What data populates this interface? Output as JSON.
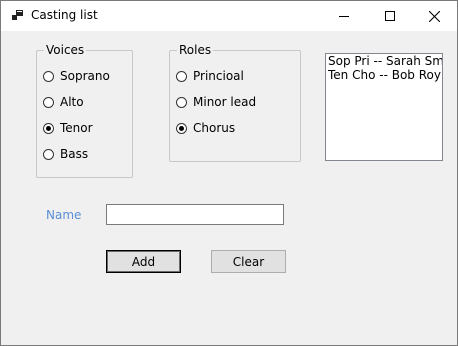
{
  "window": {
    "title": "Casting list",
    "controls": [
      "minimize",
      "maximize",
      "close"
    ]
  },
  "voices": {
    "title": "Voices",
    "options": [
      {
        "label": "Soprano",
        "checked": false
      },
      {
        "label": "Alto",
        "checked": false
      },
      {
        "label": "Tenor",
        "checked": true
      },
      {
        "label": "Bass",
        "checked": false
      }
    ]
  },
  "roles": {
    "title": "Roles",
    "options": [
      {
        "label": "Princioal",
        "checked": false
      },
      {
        "label": "Minor lead",
        "checked": false
      },
      {
        "label": "Chorus",
        "checked": true
      }
    ]
  },
  "cast_list": {
    "items": [
      "Sop Pri -- Sarah Smith",
      "Ten Cho -- Bob Roy"
    ]
  },
  "name_field": {
    "label": "Name",
    "value": ""
  },
  "buttons": {
    "add": "Add",
    "clear": "Clear"
  },
  "colors": {
    "label_accent": "#5b8ed6",
    "window_bg": "#f0f0f0"
  }
}
